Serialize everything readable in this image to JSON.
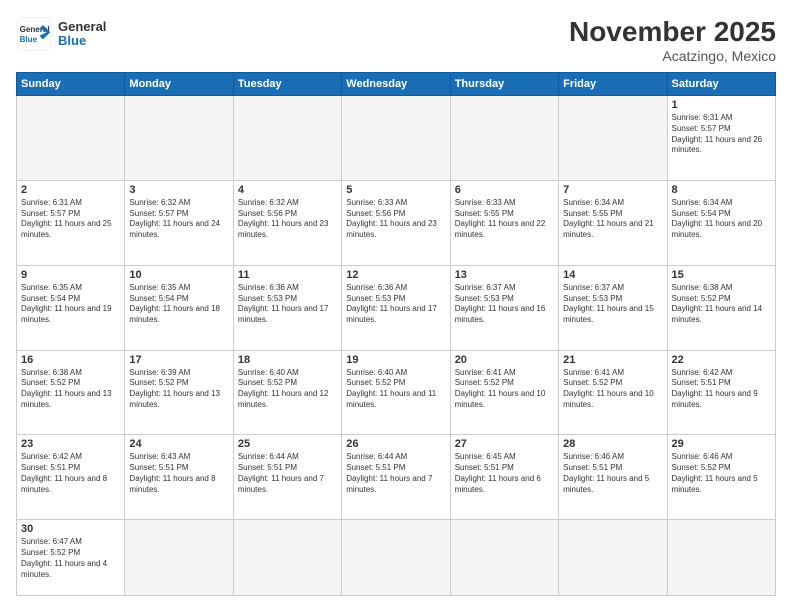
{
  "header": {
    "logo_general": "General",
    "logo_blue": "Blue",
    "month_title": "November 2025",
    "location": "Acatzingo, Mexico"
  },
  "days_of_week": [
    "Sunday",
    "Monday",
    "Tuesday",
    "Wednesday",
    "Thursday",
    "Friday",
    "Saturday"
  ],
  "weeks": [
    [
      {
        "day": "",
        "empty": true
      },
      {
        "day": "",
        "empty": true
      },
      {
        "day": "",
        "empty": true
      },
      {
        "day": "",
        "empty": true
      },
      {
        "day": "",
        "empty": true
      },
      {
        "day": "",
        "empty": true
      },
      {
        "day": "1",
        "sunrise": "6:31 AM",
        "sunset": "5:57 PM",
        "daylight": "11 hours and 26 minutes."
      }
    ],
    [
      {
        "day": "2",
        "sunrise": "6:31 AM",
        "sunset": "5:57 PM",
        "daylight": "11 hours and 25 minutes."
      },
      {
        "day": "3",
        "sunrise": "6:32 AM",
        "sunset": "5:57 PM",
        "daylight": "11 hours and 24 minutes."
      },
      {
        "day": "4",
        "sunrise": "6:32 AM",
        "sunset": "5:56 PM",
        "daylight": "11 hours and 23 minutes."
      },
      {
        "day": "5",
        "sunrise": "6:33 AM",
        "sunset": "5:56 PM",
        "daylight": "11 hours and 23 minutes."
      },
      {
        "day": "6",
        "sunrise": "6:33 AM",
        "sunset": "5:55 PM",
        "daylight": "11 hours and 22 minutes."
      },
      {
        "day": "7",
        "sunrise": "6:34 AM",
        "sunset": "5:55 PM",
        "daylight": "11 hours and 21 minutes."
      },
      {
        "day": "8",
        "sunrise": "6:34 AM",
        "sunset": "5:54 PM",
        "daylight": "11 hours and 20 minutes."
      }
    ],
    [
      {
        "day": "9",
        "sunrise": "6:35 AM",
        "sunset": "5:54 PM",
        "daylight": "11 hours and 19 minutes."
      },
      {
        "day": "10",
        "sunrise": "6:35 AM",
        "sunset": "5:54 PM",
        "daylight": "11 hours and 18 minutes."
      },
      {
        "day": "11",
        "sunrise": "6:36 AM",
        "sunset": "5:53 PM",
        "daylight": "11 hours and 17 minutes."
      },
      {
        "day": "12",
        "sunrise": "6:36 AM",
        "sunset": "5:53 PM",
        "daylight": "11 hours and 17 minutes."
      },
      {
        "day": "13",
        "sunrise": "6:37 AM",
        "sunset": "5:53 PM",
        "daylight": "11 hours and 16 minutes."
      },
      {
        "day": "14",
        "sunrise": "6:37 AM",
        "sunset": "5:53 PM",
        "daylight": "11 hours and 15 minutes."
      },
      {
        "day": "15",
        "sunrise": "6:38 AM",
        "sunset": "5:52 PM",
        "daylight": "11 hours and 14 minutes."
      }
    ],
    [
      {
        "day": "16",
        "sunrise": "6:38 AM",
        "sunset": "5:52 PM",
        "daylight": "11 hours and 13 minutes."
      },
      {
        "day": "17",
        "sunrise": "6:39 AM",
        "sunset": "5:52 PM",
        "daylight": "11 hours and 13 minutes."
      },
      {
        "day": "18",
        "sunrise": "6:40 AM",
        "sunset": "5:52 PM",
        "daylight": "11 hours and 12 minutes."
      },
      {
        "day": "19",
        "sunrise": "6:40 AM",
        "sunset": "5:52 PM",
        "daylight": "11 hours and 11 minutes."
      },
      {
        "day": "20",
        "sunrise": "6:41 AM",
        "sunset": "5:52 PM",
        "daylight": "11 hours and 10 minutes."
      },
      {
        "day": "21",
        "sunrise": "6:41 AM",
        "sunset": "5:52 PM",
        "daylight": "11 hours and 10 minutes."
      },
      {
        "day": "22",
        "sunrise": "6:42 AM",
        "sunset": "5:51 PM",
        "daylight": "11 hours and 9 minutes."
      }
    ],
    [
      {
        "day": "23",
        "sunrise": "6:42 AM",
        "sunset": "5:51 PM",
        "daylight": "11 hours and 8 minutes."
      },
      {
        "day": "24",
        "sunrise": "6:43 AM",
        "sunset": "5:51 PM",
        "daylight": "11 hours and 8 minutes."
      },
      {
        "day": "25",
        "sunrise": "6:44 AM",
        "sunset": "5:51 PM",
        "daylight": "11 hours and 7 minutes."
      },
      {
        "day": "26",
        "sunrise": "6:44 AM",
        "sunset": "5:51 PM",
        "daylight": "11 hours and 7 minutes."
      },
      {
        "day": "27",
        "sunrise": "6:45 AM",
        "sunset": "5:51 PM",
        "daylight": "11 hours and 6 minutes."
      },
      {
        "day": "28",
        "sunrise": "6:46 AM",
        "sunset": "5:51 PM",
        "daylight": "11 hours and 5 minutes."
      },
      {
        "day": "29",
        "sunrise": "6:46 AM",
        "sunset": "5:52 PM",
        "daylight": "11 hours and 5 minutes."
      }
    ],
    [
      {
        "day": "30",
        "sunrise": "6:47 AM",
        "sunset": "5:52 PM",
        "daylight": "11 hours and 4 minutes."
      },
      {
        "day": "",
        "empty": true
      },
      {
        "day": "",
        "empty": true
      },
      {
        "day": "",
        "empty": true
      },
      {
        "day": "",
        "empty": true
      },
      {
        "day": "",
        "empty": true
      },
      {
        "day": "",
        "empty": true
      }
    ]
  ]
}
